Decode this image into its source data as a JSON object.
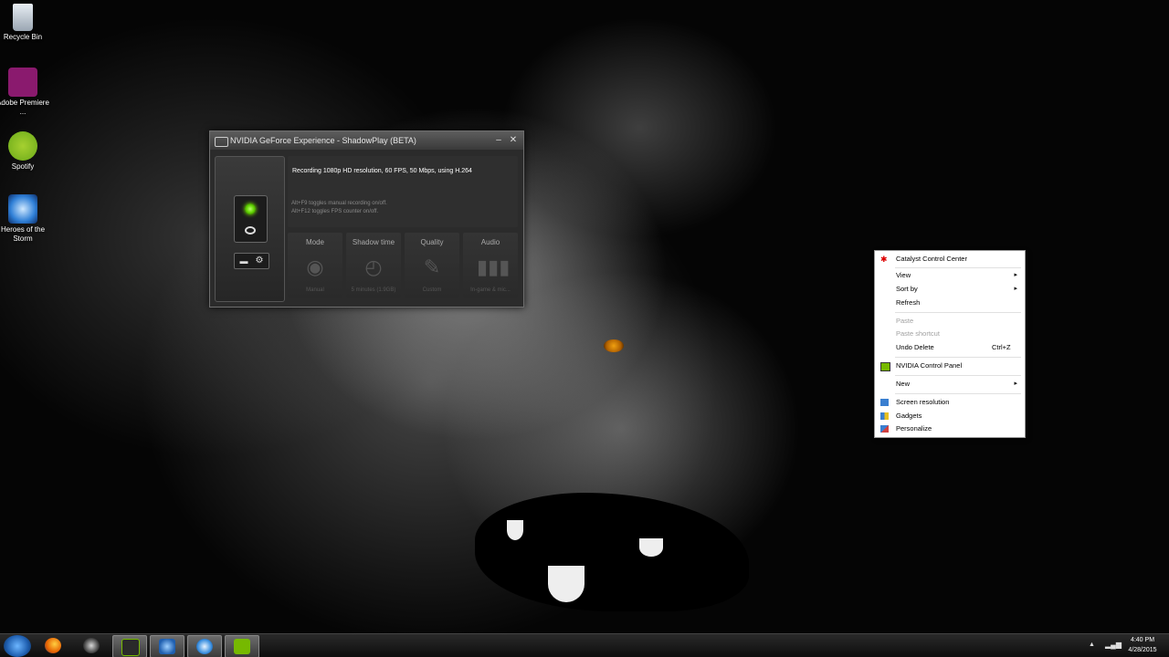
{
  "colors": {
    "nvidia_green": "#76b900",
    "led_green": "#5fd000",
    "menu_bg": "#ffffff",
    "window_bg": "#2b2b2b"
  },
  "desktop": {
    "icons": [
      {
        "label": "Recycle Bin",
        "icon": "recycle-bin-icon"
      },
      {
        "label": "Adobe Premiere ...",
        "icon": "adobe-premiere-icon"
      },
      {
        "label": "Spotify",
        "icon": "spotify-icon"
      },
      {
        "label": "Heroes of the Storm",
        "icon": "heroes-of-the-storm-icon"
      }
    ]
  },
  "gfe": {
    "title": "NVIDIA GeForce Experience - ShadowPlay (BETA)",
    "minimize": "–",
    "close": "✕",
    "status": "Recording 1080p HD resolution, 60 FPS, 50 Mbps, using H.264",
    "hint1": "Alt+F9 toggles manual recording on/off.",
    "hint2": "Alt+F12 toggles FPS counter on/off.",
    "record_state": "on",
    "tiles": [
      {
        "title": "Mode",
        "value": "Manual",
        "icon": "record-dial-icon"
      },
      {
        "title": "Shadow time",
        "value": "5 minutes (1.9GB)",
        "icon": "stopwatch-icon"
      },
      {
        "title": "Quality",
        "value": "Custom",
        "icon": "wrench-icon"
      },
      {
        "title": "Audio",
        "value": "In-game & mic...",
        "icon": "audio-bars-icon"
      }
    ]
  },
  "context_menu": {
    "items": [
      {
        "label": "Catalyst Control Center",
        "icon": "catalyst-icon",
        "enabled": true
      },
      {
        "label": "View",
        "submenu": true,
        "enabled": true
      },
      {
        "label": "Sort by",
        "submenu": true,
        "enabled": true
      },
      {
        "label": "Refresh",
        "enabled": true
      },
      {
        "label": "Paste",
        "enabled": false
      },
      {
        "label": "Paste shortcut",
        "enabled": false
      },
      {
        "label": "Undo Delete",
        "shortcut": "Ctrl+Z",
        "enabled": true
      },
      {
        "label": "NVIDIA Control Panel",
        "icon": "nvidia-icon",
        "enabled": true
      },
      {
        "label": "New",
        "submenu": true,
        "enabled": true
      },
      {
        "label": "Screen resolution",
        "icon": "screen-resolution-icon",
        "enabled": true
      },
      {
        "label": "Gadgets",
        "icon": "gadgets-icon",
        "enabled": true
      },
      {
        "label": "Personalize",
        "icon": "personalize-icon",
        "enabled": true
      }
    ],
    "submenu_arrow": "▸"
  },
  "taskbar": {
    "apps": [
      {
        "name": "Firefox",
        "icon": "firefox-icon",
        "active": false
      },
      {
        "name": "Steam",
        "icon": "steam-icon",
        "active": false
      },
      {
        "name": "NVIDIA GeForce Experience",
        "icon": "geforce-icon",
        "active": true
      },
      {
        "name": "Heroes of the Storm",
        "icon": "heroes-icon",
        "active": true
      },
      {
        "name": "Battle.net",
        "icon": "battlenet-icon",
        "active": true
      },
      {
        "name": "NVIDIA ShadowPlay",
        "icon": "shadowplay-icon",
        "active": true
      }
    ],
    "tray_arrow": "▲",
    "time": "4:40 PM",
    "date": "4/28/2015"
  }
}
